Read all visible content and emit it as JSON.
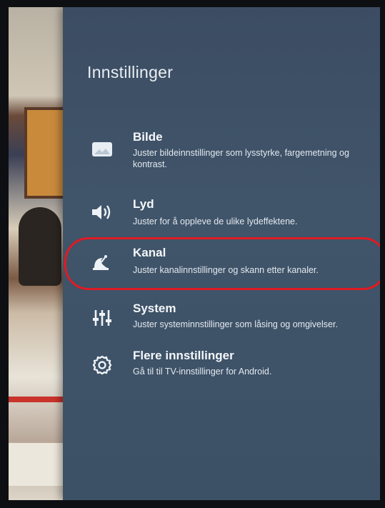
{
  "settings": {
    "title": "Innstillinger",
    "items": [
      {
        "icon": "picture-icon",
        "label": "Bilde",
        "description": "Juster bildeinnstillinger som lysstyrke, fargemetning og kontrast."
      },
      {
        "icon": "speaker-icon",
        "label": "Lyd",
        "description": "Juster for å oppleve de ulike lydeffektene."
      },
      {
        "icon": "satellite-dish-icon",
        "label": "Kanal",
        "description": "Juster kanalinnstillinger og skann etter kanaler.",
        "highlighted": true
      },
      {
        "icon": "sliders-icon",
        "label": "System",
        "description": "Juster systeminnstillinger som låsing og omgivelser."
      },
      {
        "icon": "gear-icon",
        "label": "Flere innstillinger",
        "description": "Gå til til TV-innstillinger for Android."
      }
    ]
  },
  "colors": {
    "panel": "#3d5166",
    "text": "#f4f7fa",
    "highlight_ring": "#e01b22"
  }
}
